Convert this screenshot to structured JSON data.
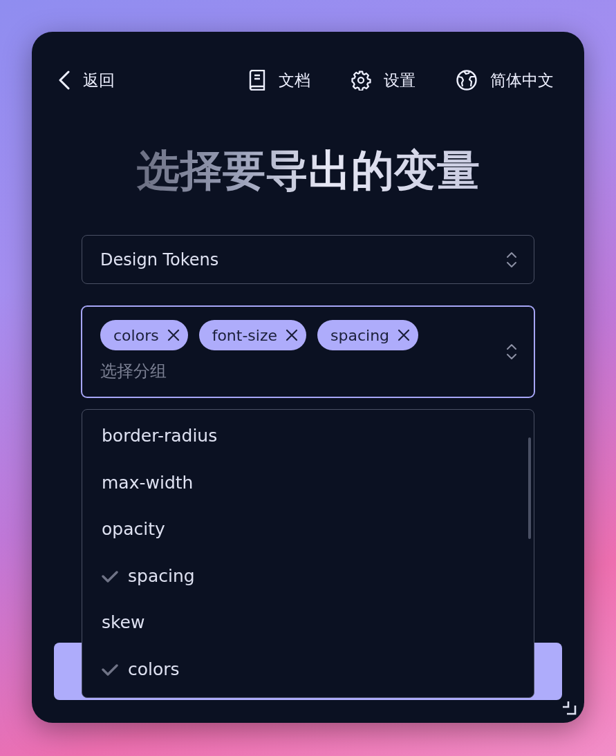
{
  "nav": {
    "back": {
      "label": "返回"
    },
    "links": [
      {
        "label": "文档"
      },
      {
        "label": "设置"
      },
      {
        "label": "简体中文"
      }
    ]
  },
  "title": {
    "muted": "选择要",
    "bright": "导出的变量"
  },
  "source_select": {
    "value": "Design Tokens"
  },
  "group_select": {
    "focused": true,
    "placeholder": "选择分组",
    "tags": [
      {
        "label": "colors"
      },
      {
        "label": "font-size"
      },
      {
        "label": "spacing"
      }
    ]
  },
  "dropdown": {
    "options": [
      {
        "label": "border-radius",
        "selected": false
      },
      {
        "label": "max-width",
        "selected": false
      },
      {
        "label": "opacity",
        "selected": false
      },
      {
        "label": "spacing",
        "selected": true
      },
      {
        "label": "skew",
        "selected": false
      },
      {
        "label": "colors",
        "selected": true
      }
    ]
  }
}
